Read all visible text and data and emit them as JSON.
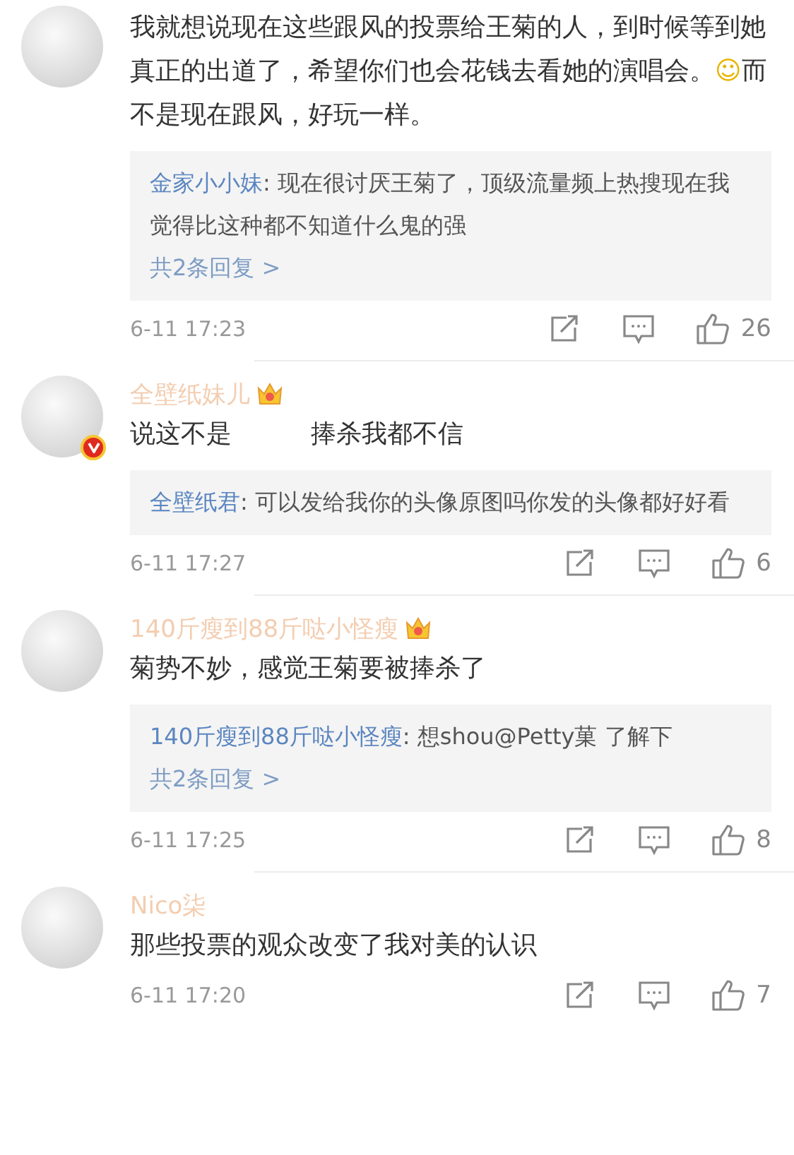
{
  "comments": [
    {
      "text": [
        {
          "kind": "text",
          "text": "我就想说现在这些跟风的投票给王菊的人，到时候等到她真正的出道了，希望你们也会花钱去看她的演唱会。"
        },
        {
          "kind": "emoji",
          "text": "☺"
        },
        {
          "kind": "text",
          "text": "而不是现在跟风，好玩一样。"
        }
      ],
      "reply": {
        "author": "金家小小妹",
        "text": ": 现在很讨厌王菊了，顶级流量频上热搜现在我觉得比这种都不知道什么鬼的强",
        "more": "共2条回复 >"
      },
      "time": "6-11 17:23",
      "likes": "26"
    },
    {
      "name": "全壁纸妹儿",
      "crown": true,
      "verified": true,
      "text": [
        {
          "kind": "text",
          "text": "说这不是"
        },
        {
          "kind": "gap"
        },
        {
          "kind": "text",
          "text": "捧杀我都不信"
        }
      ],
      "reply": {
        "author": "全壁纸君",
        "text": ": 可以发给我你的头像原图吗你发的头像都好好看"
      },
      "time": "6-11 17:27",
      "likes": "6"
    },
    {
      "name": "140斤瘦到88斤哒小怪瘦",
      "crown": true,
      "text": [
        {
          "kind": "text",
          "text": "菊势不妙，感觉王菊要被捧杀了"
        }
      ],
      "reply": {
        "author": "140斤瘦到88斤哒小怪瘦",
        "text": ": 想shou@Petty菓 了解下",
        "more": "共2条回复 >"
      },
      "time": "6-11 17:25",
      "likes": "8"
    },
    {
      "name": "Nico柒",
      "text": [
        {
          "kind": "text",
          "text": "那些投票的观众改变了我对美的认识"
        }
      ],
      "time": "6-11 17:20",
      "likes": "7"
    }
  ]
}
